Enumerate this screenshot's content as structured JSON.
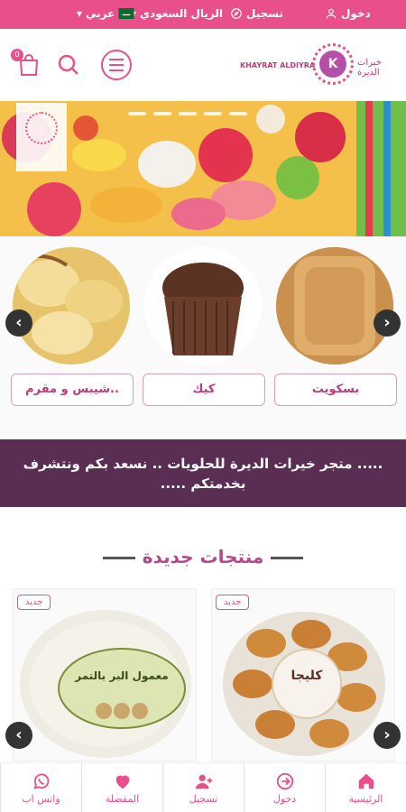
{
  "topbar": {
    "login": "دخول",
    "register": "تسجيل",
    "currency": "الريال السعودي",
    "language": "عربي"
  },
  "header": {
    "logo_en": "KHAYRAT ALDIYRA",
    "logo_ar": "خيرات الديرة",
    "logo_mark": "K",
    "cart_count": "0"
  },
  "categories": [
    {
      "label": "بسكويت"
    },
    {
      "label": "كيك"
    },
    {
      "label": "شيبس و مقرم.."
    }
  ],
  "welcome": {
    "text": "..... متجر خيرات الديرة للحلويات .. نسعد بكم ونتشرف بخدمتكم ....."
  },
  "new_products": {
    "title": "منتجات جديدة",
    "tag": "جديد",
    "items": [
      {
        "tag": "جديد",
        "package_text": "كليجا"
      },
      {
        "tag": "جديد",
        "package_text": "معمول البر بالتمر"
      }
    ]
  },
  "nav": [
    {
      "label": "الرئيسية",
      "icon": "home-icon"
    },
    {
      "label": "دخول",
      "icon": "login-icon"
    },
    {
      "label": "تسجيل",
      "icon": "add-user-icon"
    },
    {
      "label": "المفضلة",
      "icon": "heart-icon"
    },
    {
      "label": "واتس اب",
      "icon": "whatsapp-icon"
    }
  ],
  "colors": {
    "brand_pink": "#e94f8a",
    "banner_purple": "#5a2d52",
    "title_purple": "#b24a8a"
  }
}
